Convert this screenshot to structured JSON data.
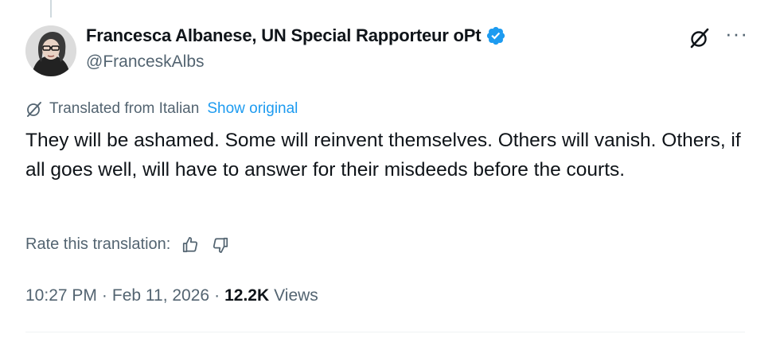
{
  "author": {
    "display_name": "Francesca Albanese, UN Special Rapporteur oPt",
    "handle": "@FranceskAlbs",
    "verified": true
  },
  "translation": {
    "notice": "Translated from Italian",
    "show_original": "Show original",
    "rate_label": "Rate this translation:"
  },
  "tweet": {
    "text": "They will be ashamed. Some will reinvent themselves. Others will vanish. Others, if all goes well, will have to answer for their misdeeds before the courts."
  },
  "meta": {
    "time": "10:27 PM",
    "separator": "·",
    "date": "Feb 11, 2026",
    "views_count": "12.2K",
    "views_label": "Views"
  },
  "icons": {
    "verified": "verified-badge-icon",
    "grok": "grok-icon",
    "more": "more-options-icon",
    "translate": "translate-icon",
    "thumbs_up": "thumbs-up-icon",
    "thumbs_down": "thumbs-down-icon"
  },
  "colors": {
    "accent": "#1d9bf0",
    "secondary_text": "#536471",
    "primary_text": "#0f1419"
  }
}
